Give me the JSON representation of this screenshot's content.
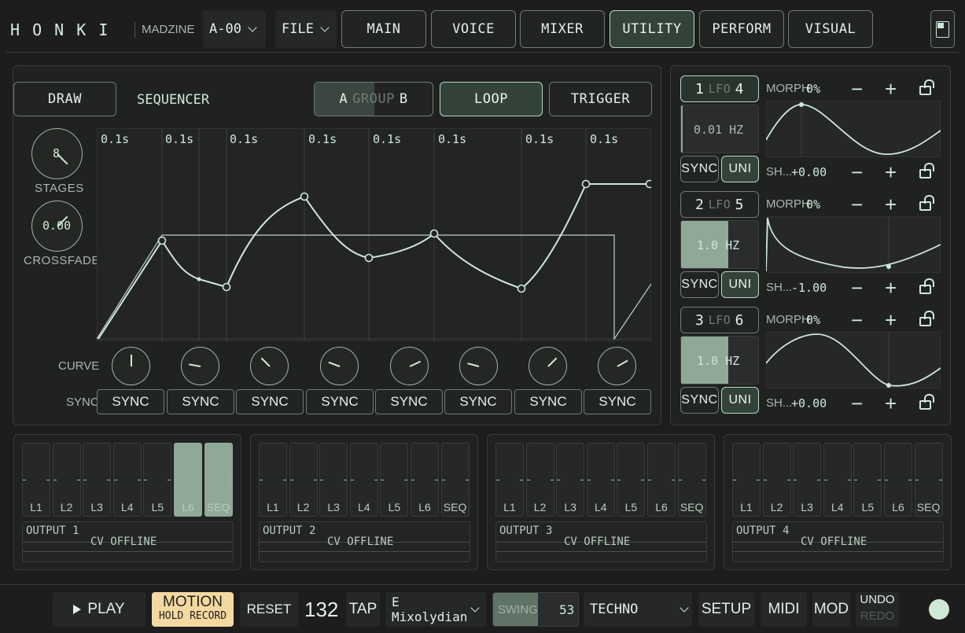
{
  "header": {
    "logo": "H O N K I",
    "preset_bank": "MADZINE",
    "preset": "A-00",
    "file": "FILE",
    "tabs": [
      "MAIN",
      "VOICE",
      "MIXER",
      "UTILITY",
      "PERFORM",
      "VISUAL"
    ],
    "active_tab": "UTILITY"
  },
  "seq": {
    "draw": "DRAW",
    "title": "SEQUENCER",
    "group_a": "A",
    "group_word": "GROUP",
    "group_b": "B",
    "loop": "LOOP",
    "trigger": "TRIGGER",
    "stages_value": "8",
    "stages_label": "STAGES",
    "crossfade_value": "0.00",
    "crossfade_label": "CROSSFADE",
    "times": [
      "0.1s",
      "0.1s",
      "0.1s",
      "0.1s",
      "0.1s",
      "0.1s",
      "0.1s",
      "0.1s"
    ],
    "curve_label": "CURVE",
    "sync_label": "SYNC",
    "sync_buttons": [
      "SYNC",
      "SYNC",
      "SYNC",
      "SYNC",
      "SYNC",
      "SYNC",
      "SYNC",
      "SYNC"
    ]
  },
  "lfos": [
    {
      "num_a": "1",
      "word": "LFO",
      "num_b": "4",
      "rate": "0.01 HZ",
      "rate_fill": 0.0,
      "sync": "SYNC",
      "uni": "UNI",
      "morph_label": "MORPH",
      "morph": "0%",
      "shape_label": "SH...",
      "shape": "+0.00"
    },
    {
      "num_a": "2",
      "word": "LFO",
      "num_b": "5",
      "rate": "1.0 HZ",
      "rate_fill": 0.6,
      "sync": "SYNC",
      "uni": "UNI",
      "morph_label": "MORPH",
      "morph": "0%",
      "shape_label": "SH...",
      "shape": "-1.00"
    },
    {
      "num_a": "3",
      "word": "LFO",
      "num_b": "6",
      "rate": "1.0 HZ",
      "rate_fill": 0.6,
      "sync": "SYNC",
      "uni": "UNI",
      "morph_label": "MORPH",
      "morph": "0%",
      "shape_label": "SH...",
      "shape": "+0.00"
    }
  ],
  "lfo_controls": {
    "minus": "−",
    "plus": "+"
  },
  "outputs": [
    {
      "name": "OUTPUT 1",
      "status": "CV OFFLINE",
      "lanes": [
        "L1",
        "L2",
        "L3",
        "L4",
        "L5",
        "L6",
        "SEQ"
      ],
      "active": [
        5,
        6
      ]
    },
    {
      "name": "OUTPUT 2",
      "status": "CV OFFLINE",
      "lanes": [
        "L1",
        "L2",
        "L3",
        "L4",
        "L5",
        "L6",
        "SEQ"
      ],
      "active": []
    },
    {
      "name": "OUTPUT 3",
      "status": "CV OFFLINE",
      "lanes": [
        "L1",
        "L2",
        "L3",
        "L4",
        "L5",
        "L6",
        "SEQ"
      ],
      "active": []
    },
    {
      "name": "OUTPUT 4",
      "status": "CV OFFLINE",
      "lanes": [
        "L1",
        "L2",
        "L3",
        "L4",
        "L5",
        "L6",
        "SEQ"
      ],
      "active": []
    }
  ],
  "footer": {
    "play": "PLAY",
    "motion": "MOTION",
    "hold_record": "HOLD RECORD",
    "reset": "RESET",
    "bpm": "132",
    "tap": "TAP",
    "scale_root": "E",
    "scale_mode": "Mixolydian",
    "swing_label": "SWING",
    "swing": "53",
    "swing_fill": 0.5,
    "genre": "TECHNO",
    "setup": "SETUP",
    "midi": "MIDI",
    "mod": "MOD",
    "undo": "UNDO",
    "redo": "REDO"
  },
  "colors": {
    "accent": "#cfe8d8",
    "bg": "#1c1d1c",
    "active_fill": "#8fa897",
    "motion": "#f3d9a0"
  }
}
